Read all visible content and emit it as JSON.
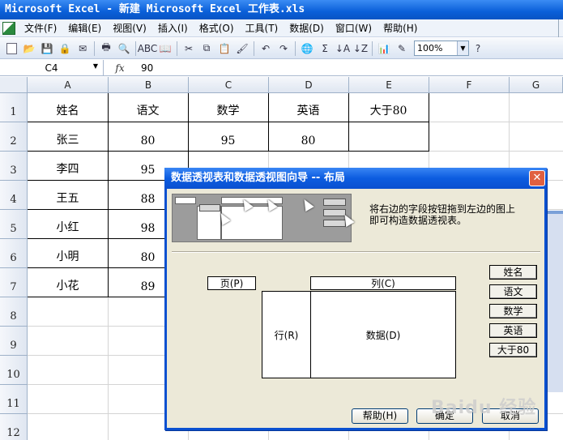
{
  "window": {
    "title": "Microsoft Excel - 新建 Microsoft Excel 工作表.xls"
  },
  "menu": [
    "文件(F)",
    "编辑(E)",
    "视图(V)",
    "插入(I)",
    "格式(O)",
    "工具(T)",
    "数据(D)",
    "窗口(W)",
    "帮助(H)"
  ],
  "toolbar": {
    "zoom": "100%",
    "icons": [
      "new-icon",
      "open-icon",
      "save-icon",
      "permission-icon",
      "email-icon",
      "print-icon",
      "print-preview-icon",
      "spelling-icon",
      "research-icon",
      "cut-icon",
      "copy-icon",
      "paste-icon",
      "format-painter-icon",
      "undo-icon",
      "redo-icon",
      "hyperlink-icon",
      "autosum-icon",
      "sort-ascending-icon",
      "sort-descending-icon",
      "chart-wizard-icon",
      "drawing-icon",
      "help-icon"
    ]
  },
  "formula_bar": {
    "name_box": "C4",
    "fx": "fx",
    "value": "90"
  },
  "grid": {
    "columns": [
      "A",
      "B",
      "C",
      "D",
      "E",
      "F",
      "G"
    ],
    "rows": [
      "1",
      "2",
      "3",
      "4",
      "5",
      "6",
      "7",
      "8",
      "9",
      "10",
      "11",
      "12"
    ],
    "headers": [
      "姓名",
      "语文",
      "数学",
      "英语",
      "大于80"
    ],
    "names": [
      "张三",
      "李四",
      "王五",
      "小红",
      "小明",
      "小花"
    ],
    "chinese": [
      "80",
      "95",
      "88",
      "98",
      "80",
      "89"
    ],
    "c2": "95",
    "d2": "80"
  },
  "dialog": {
    "title": "数据透视表和数据透视图向导 -- 布局",
    "hint_line1": "将右边的字段按钮拖到左边的图上",
    "hint_line2": "即可构造数据透视表。",
    "page_label": "页(P)",
    "column_label": "列(C)",
    "row_label": "行(R)",
    "data_label": "数据(D)",
    "fields": [
      "姓名",
      "语文",
      "数学",
      "英语",
      "大于80"
    ],
    "help_button": "帮助(H)",
    "ok_button": "确定",
    "cancel_button": "取消"
  },
  "watermark": {
    "brand": "Baidu 经验"
  }
}
